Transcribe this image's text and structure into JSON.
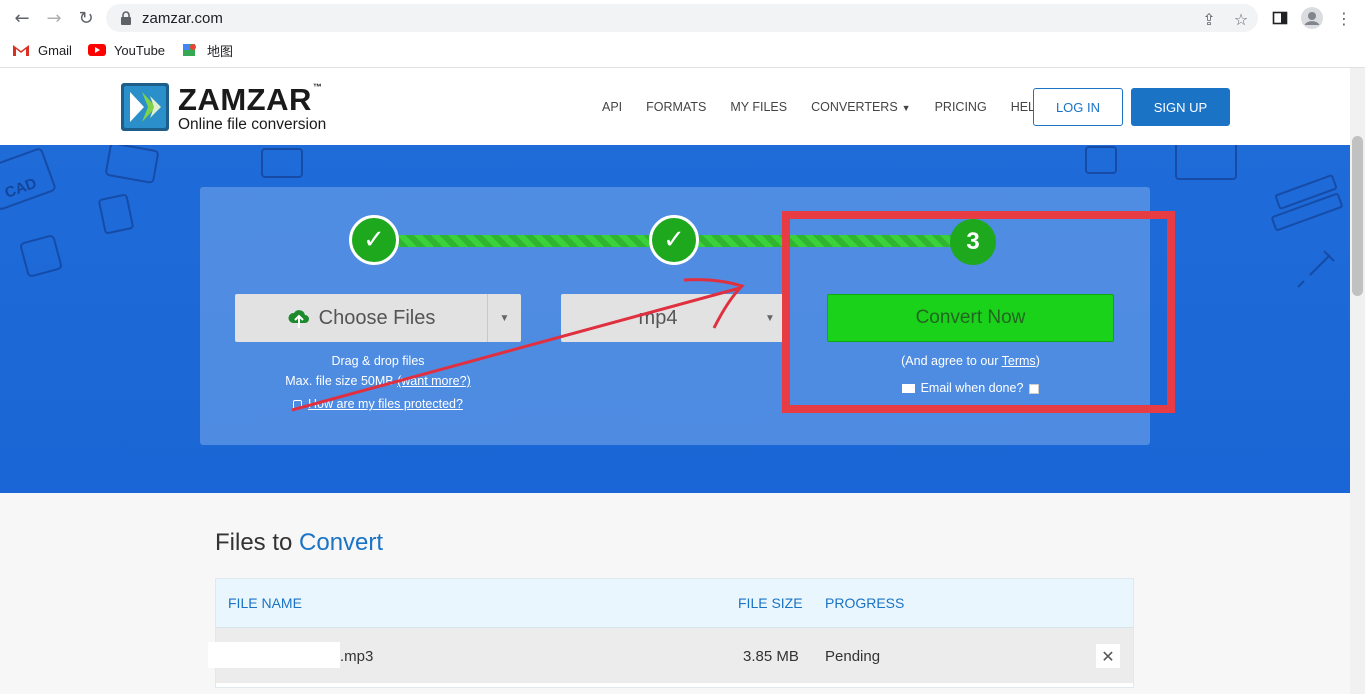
{
  "browser": {
    "url": "zamzar.com",
    "bookmarks": [
      "Gmail",
      "YouTube",
      "地图"
    ]
  },
  "header": {
    "logo_name": "ZAMZAR",
    "logo_tm": "™",
    "logo_tagline": "Online file conversion",
    "nav": [
      "API",
      "FORMATS",
      "MY FILES",
      "CONVERTERS",
      "PRICING",
      "HELP"
    ],
    "login_label": "LOG IN",
    "signup_label": "SIGN UP"
  },
  "converter": {
    "step1_mark": "✓",
    "step2_mark": "✓",
    "step3_number": "3",
    "choose_label": "Choose Files",
    "format_value": "mp4",
    "convert_label": "Convert Now",
    "drag_text": "Drag & drop files",
    "max_size_text": "Max. file size 50MB",
    "want_more": "(want more?)",
    "protected_link": "How are my files protected?",
    "agree_prefix": "(And agree to our ",
    "terms": "Terms",
    "agree_suffix": ")",
    "email_label": "Email when done?"
  },
  "files": {
    "title_main": "Files to ",
    "title_accent": "Convert",
    "columns": [
      "FILE NAME",
      "FILE SIZE",
      "PROGRESS"
    ],
    "rows": [
      {
        "name": ".mp3",
        "size": "3.85 MB",
        "progress": "Pending"
      }
    ]
  },
  "colors": {
    "brand_blue": "#1a73c5",
    "convert_green": "#19d219",
    "annotation_red": "#e83c45"
  }
}
